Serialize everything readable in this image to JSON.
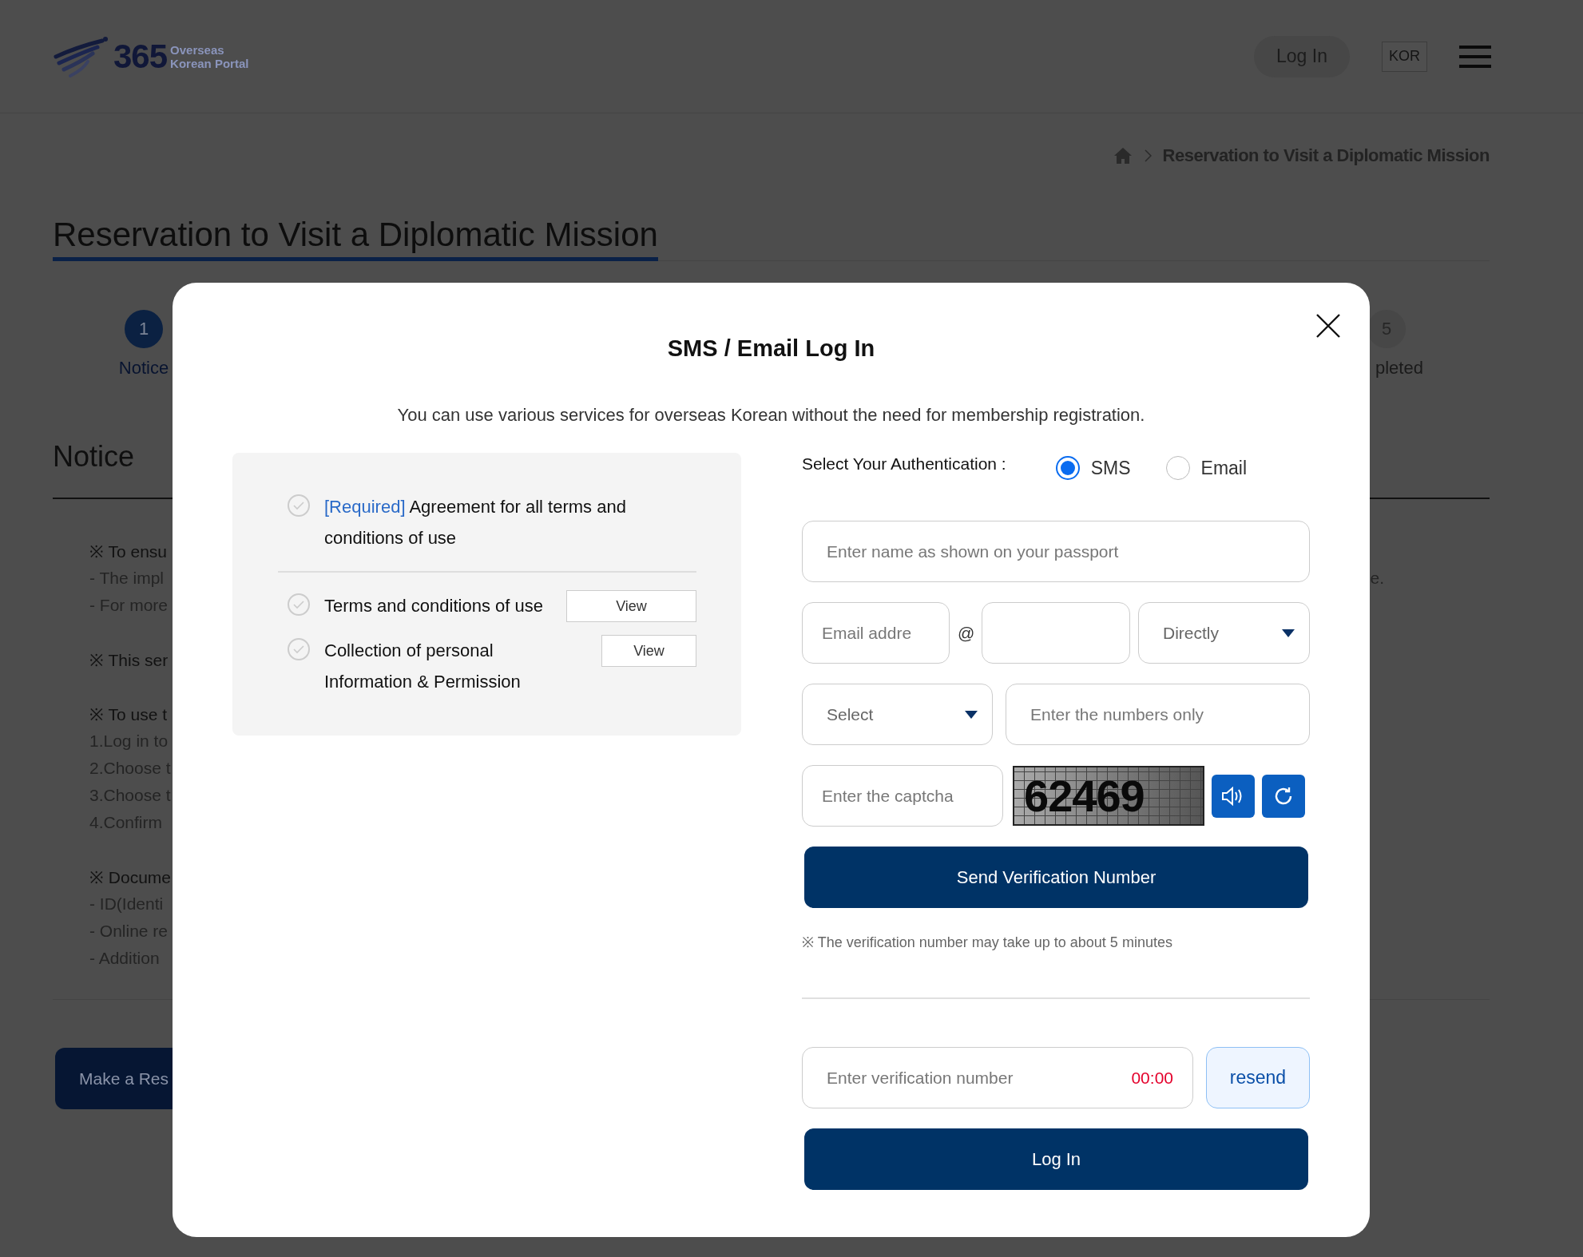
{
  "header": {
    "logo": {
      "number": "365",
      "line_1": "Overseas",
      "line_2": "Korean Portal"
    },
    "login_button": "Log In",
    "language_button": "KOR"
  },
  "breadcrumb": {
    "current": "Reservation to Visit a Diplomatic Mission"
  },
  "page_title": "Reservation to Visit a Diplomatic Mission",
  "steps": [
    {
      "number": "1",
      "label": "Notice",
      "selected": true
    },
    {
      "number": "5",
      "label": "pleted",
      "selected": false
    }
  ],
  "notice": {
    "heading": "Notice",
    "lines": [
      {
        "kind": "heading",
        "text": "※ To ensu"
      },
      {
        "kind": "item",
        "text": "- The impl",
        "end": "e."
      },
      {
        "kind": "item",
        "text": "- For more"
      },
      {
        "kind": "gap"
      },
      {
        "kind": "heading",
        "text": "※ This ser"
      },
      {
        "kind": "gap"
      },
      {
        "kind": "heading",
        "text": "※ To use t"
      },
      {
        "kind": "item",
        "text": "1.Log in to"
      },
      {
        "kind": "item",
        "text": "2.Choose t"
      },
      {
        "kind": "item",
        "text": "3.Choose t"
      },
      {
        "kind": "item",
        "text": "4.Confirm"
      },
      {
        "kind": "gap"
      },
      {
        "kind": "heading",
        "text": "※ Docume"
      },
      {
        "kind": "item",
        "text": "- ID(Identi"
      },
      {
        "kind": "item",
        "text": "- Online re"
      },
      {
        "kind": "item",
        "text": "- Addition"
      }
    ]
  },
  "reserve_button": "Make a Res",
  "modal": {
    "title": "SMS / Email Log In",
    "subtitle": "You can use various services for overseas Korean without the need for membership registration.",
    "agreements": [
      {
        "kind": "all",
        "tag": "[Required]",
        "text": "Agreement for all terms and conditions of use",
        "checked": false
      },
      {
        "kind": "item",
        "text": "Terms and conditions of use",
        "checked": false,
        "button": "View"
      },
      {
        "kind": "item",
        "text": "Collection of personal Information & Permission",
        "checked": false,
        "button": "View"
      }
    ],
    "auth": {
      "label": "Select Your Authentication :",
      "options": [
        {
          "label": "SMS",
          "selected": true
        },
        {
          "label": "Email",
          "selected": false
        }
      ]
    },
    "name_field": {
      "placeholder": "Enter name as shown on your passport"
    },
    "email": {
      "local_placeholder": "Email addre",
      "at": "@",
      "domain_select": "Directly"
    },
    "phone": {
      "country_select": "Select",
      "placeholder": "Enter the numbers only"
    },
    "captcha": {
      "placeholder": "Enter the captcha",
      "code": "62469"
    },
    "send_button": "Send Verification Number",
    "note": "※ The verification number may take up to about 5 minutes",
    "verification": {
      "placeholder": "Enter verification number",
      "timer": "00:00",
      "resend_button": "resend"
    },
    "login_button": "Log In"
  }
}
